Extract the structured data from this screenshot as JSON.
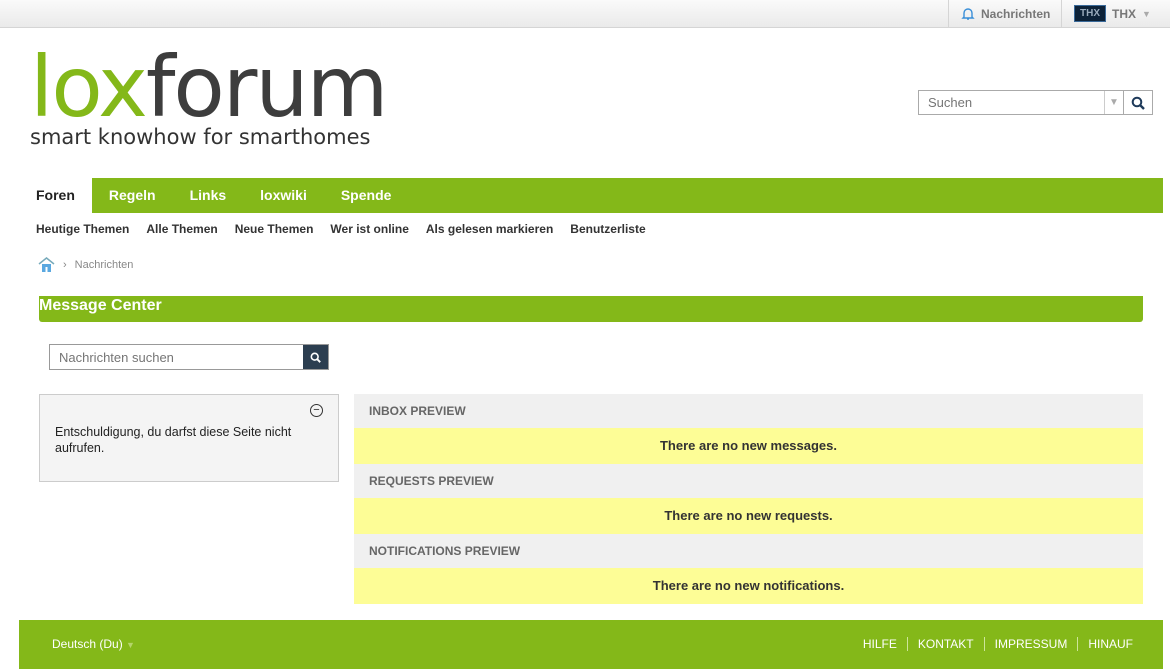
{
  "topbar": {
    "notifications": "Nachrichten",
    "avatar_text": "THX",
    "user": "THX"
  },
  "logo": {
    "part1": "lox",
    "part2": "forum",
    "tagline": "smart knowhow for smarthomes"
  },
  "search": {
    "placeholder": "Suchen"
  },
  "nav": {
    "tabs": [
      "Foren",
      "Regeln",
      "Links",
      "loxwiki",
      "Spende"
    ]
  },
  "subnav": [
    "Heutige Themen",
    "Alle Themen",
    "Neue Themen",
    "Wer ist online",
    "Als gelesen markieren",
    "Benutzerliste"
  ],
  "breadcrumb": {
    "current": "Nachrichten"
  },
  "message_center": {
    "title": "Message Center",
    "search_placeholder": "Nachrichten suchen",
    "error": "Entschuldigung, du darfst diese Seite nicht aufrufen.",
    "sections": [
      {
        "title": "INBOX PREVIEW",
        "body": "There are no new messages."
      },
      {
        "title": "REQUESTS PREVIEW",
        "body": "There are no new requests."
      },
      {
        "title": "NOTIFICATIONS PREVIEW",
        "body": "There are no new notifications."
      }
    ]
  },
  "footer": {
    "language": "Deutsch (Du)",
    "links": [
      "HILFE",
      "KONTAKT",
      "IMPRESSUM",
      "HINAUF"
    ]
  }
}
